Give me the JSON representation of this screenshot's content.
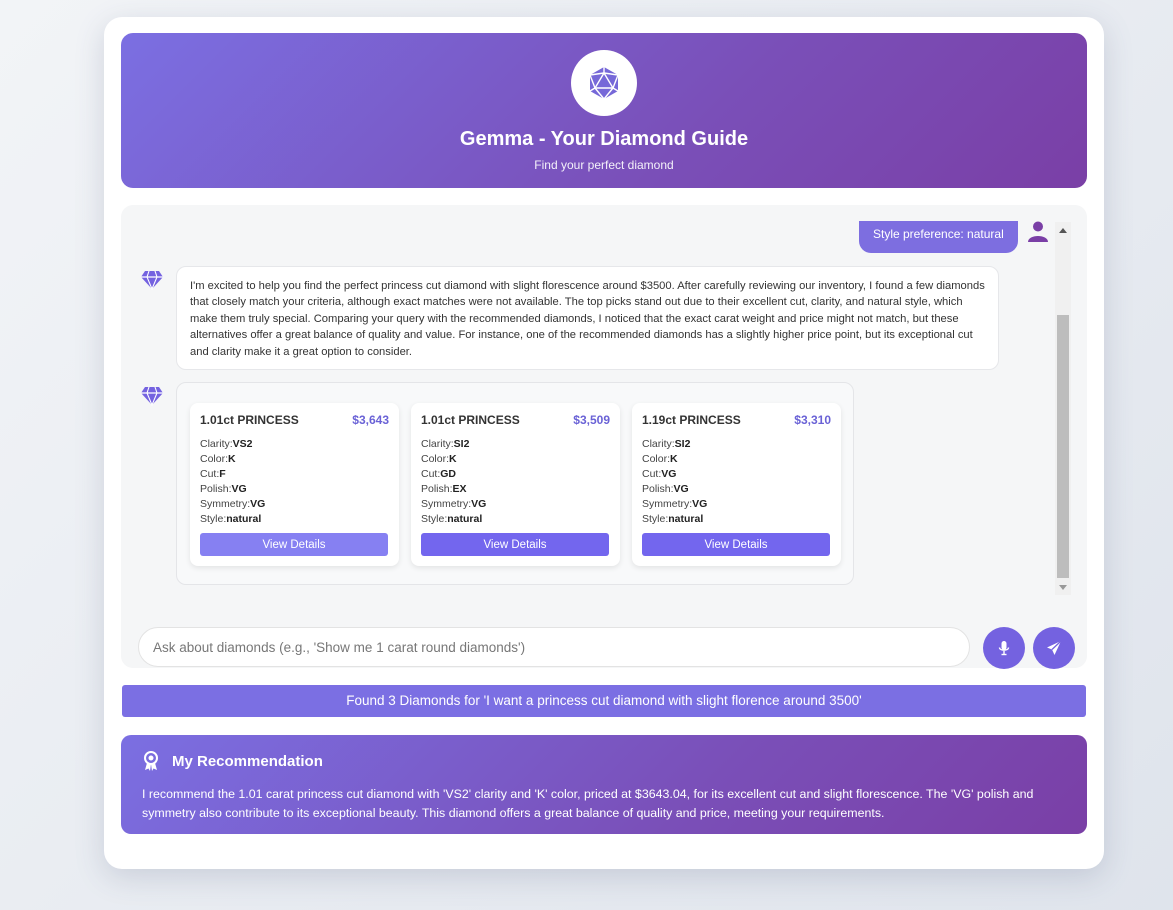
{
  "header": {
    "title": "Gemma - Your Diamond Guide",
    "subtitle": "Find your perfect diamond",
    "logo_icon": "diamond-icosahedron-icon"
  },
  "chat": {
    "user_message": "Style preference: natural",
    "bot_message": "I'm excited to help you find the perfect princess cut diamond with slight florescence around $3500. After carefully reviewing our inventory, I found a few diamonds that closely match your criteria, although exact matches were not available. The top picks stand out due to their excellent cut, clarity, and natural style, which make them truly special. Comparing your query with the recommended diamonds, I noticed that the exact carat weight and price might not match, but these alternatives offer a great balance of quality and value. For instance, one of the recommended diamonds has a slightly higher price point, but its exceptional cut and clarity make it a great option to consider.",
    "diamonds": [
      {
        "title": "1.01ct PRINCESS",
        "price": "$3,643",
        "clarity": "VS2",
        "color": "K",
        "cut": "F",
        "polish": "VG",
        "symmetry": "VG",
        "style": "natural",
        "button": "View Details"
      },
      {
        "title": "1.01ct PRINCESS",
        "price": "$3,509",
        "clarity": "SI2",
        "color": "K",
        "cut": "GD",
        "polish": "EX",
        "symmetry": "VG",
        "style": "natural",
        "button": "View Details"
      },
      {
        "title": "1.19ct PRINCESS",
        "price": "$3,310",
        "clarity": "SI2",
        "color": "K",
        "cut": "VG",
        "polish": "VG",
        "symmetry": "VG",
        "style": "natural",
        "button": "View Details"
      }
    ],
    "labels": {
      "clarity": "Clarity:",
      "color": "Color:",
      "cut": "Cut:",
      "polish": "Polish:",
      "symmetry": "Symmetry:",
      "style": "Style:"
    }
  },
  "input": {
    "placeholder": "Ask about diamonds (e.g., 'Show me 1 carat round diamonds')",
    "mic_icon": "microphone-icon",
    "send_icon": "send-icon"
  },
  "status": {
    "text": "Found 3 Diamonds for 'I want a princess cut diamond with slight florence around 3500'"
  },
  "recommendation": {
    "title": "My Recommendation",
    "icon": "award-icon",
    "text": "I recommend the 1.01 carat princess cut diamond with 'VS2' clarity and 'K' color, priced at $3643.04, for its excellent cut and slight florescence. The 'VG' polish and symmetry also contribute to its exceptional beauty. This diamond offers a great balance of quality and price, meeting your requirements."
  },
  "colors": {
    "accent": "#7366ee",
    "gradient_start": "#7b6fe2",
    "gradient_end": "#7a3fa6",
    "price": "#6a62d6"
  }
}
